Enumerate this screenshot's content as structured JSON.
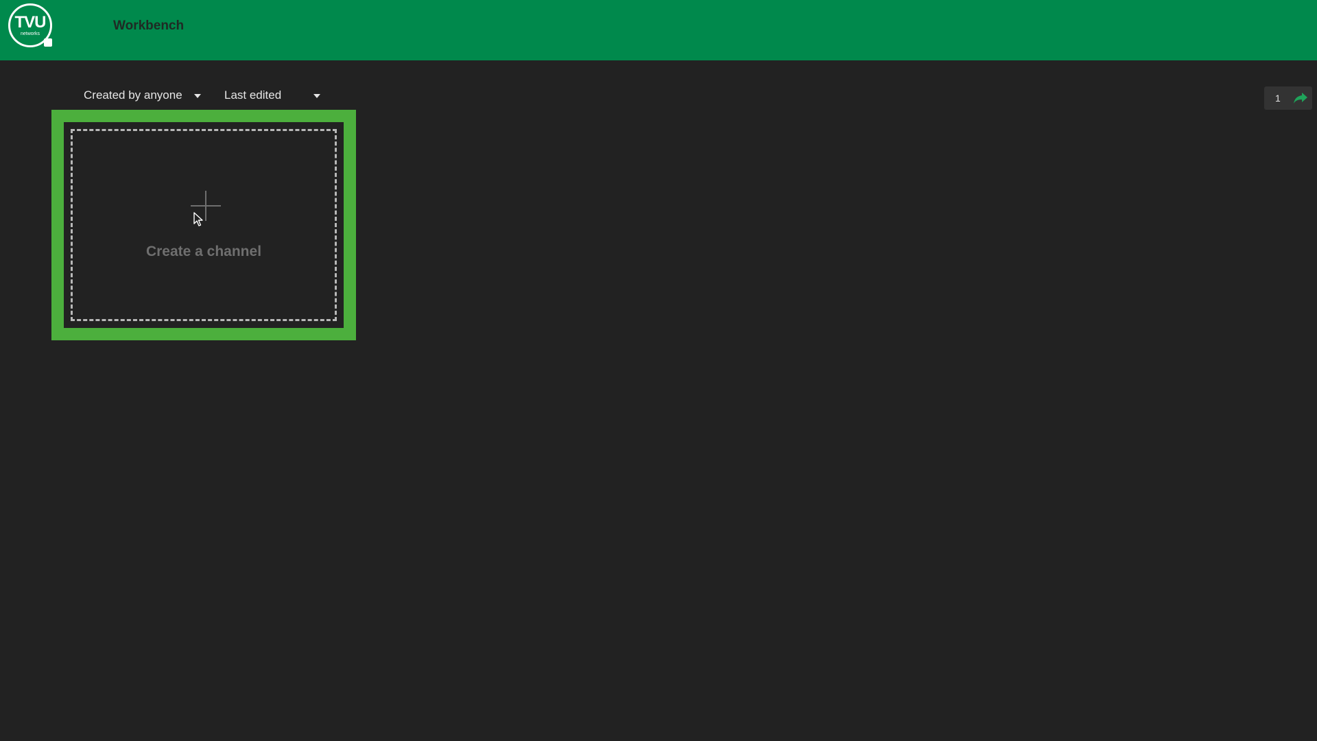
{
  "header": {
    "logo_text": "TVU",
    "logo_subtext": "networks",
    "title": "Workbench",
    "background_color": "#00894c"
  },
  "filters": {
    "created_by": "Created by anyone",
    "sort": "Last edited"
  },
  "card": {
    "label": "Create a channel",
    "highlight_color": "#4caf3d",
    "icon": "plus-icon"
  },
  "pagination": {
    "page": "1",
    "icon": "share-icon",
    "icon_color": "#1fa35a"
  },
  "colors": {
    "page_background": "#222222",
    "text_primary": "#e6e6e6",
    "text_muted": "#6f6f6f"
  }
}
